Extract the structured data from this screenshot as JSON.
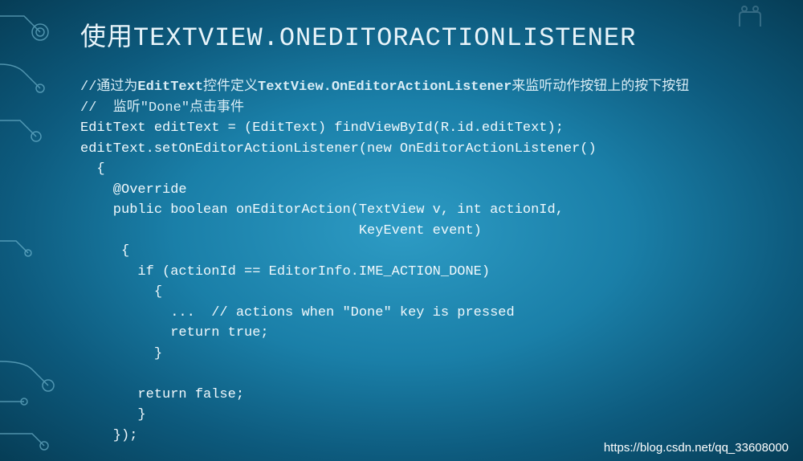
{
  "title_prefix": "使用",
  "title_main": "TEXTVIEW.ONEDITORACTIONLISTENER",
  "code": {
    "line1_a": "//通过为",
    "line1_b": "EditText",
    "line1_c": "控件定义",
    "line1_d": "TextView.OnEditorActionListener",
    "line1_e": "来监听动作按钮上的按下按钮",
    "line2": "//  监听\"Done\"点击事件",
    "line3": "EditText editText = (EditText) findViewById(R.id.editText);",
    "line4": "editText.setOnEditorActionListener(new OnEditorActionListener()",
    "line5": "  {",
    "line6": "    @Override",
    "line7": "    public boolean onEditorAction(TextView v, int actionId,",
    "line8": "                                  KeyEvent event)",
    "line9": "     {",
    "line10": "       if (actionId == EditorInfo.IME_ACTION_DONE)",
    "line11": "         {",
    "line12": "           ...  // actions when \"Done\" key is pressed",
    "line13": "           return true;",
    "line14": "         }",
    "line15": "",
    "line16": "       return false;",
    "line17": "       }",
    "line18": "    });"
  },
  "footer_url": "https://blog.csdn.net/qq_33608000"
}
